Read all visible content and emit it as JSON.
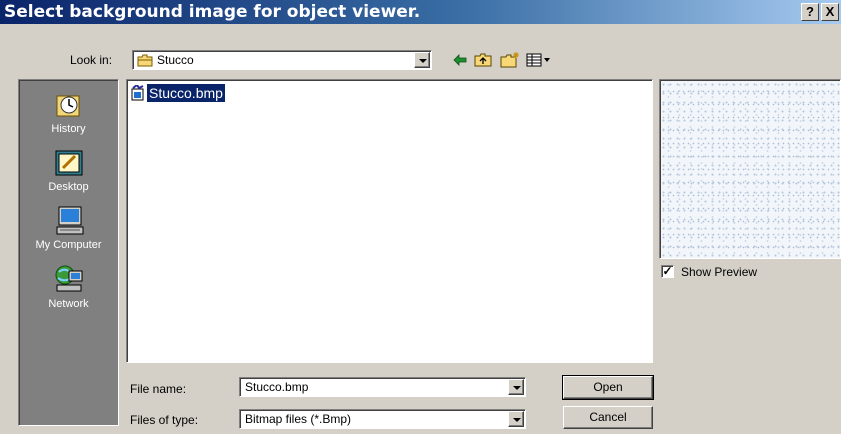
{
  "window": {
    "title": "Select background image for object viewer.",
    "help_label": "?",
    "close_label": "X"
  },
  "toolbar": {
    "look_in_label": "Look in:",
    "look_in_value": "Stucco"
  },
  "places": [
    {
      "label": "History",
      "icon": "history-icon"
    },
    {
      "label": "Desktop",
      "icon": "desktop-icon"
    },
    {
      "label": "My Computer",
      "icon": "my-computer-icon"
    },
    {
      "label": "Network",
      "icon": "network-icon"
    }
  ],
  "files": [
    {
      "name": "Stucco.bmp",
      "selected": true,
      "icon": "bitmap-file-icon"
    }
  ],
  "preview": {
    "show_preview_label": "Show Preview",
    "show_preview_checked": true
  },
  "form": {
    "file_name_label": "File name:",
    "file_name_value": "Stucco.bmp",
    "file_type_label": "Files of type:",
    "file_type_value": "Bitmap files (*.Bmp)",
    "open_label": "Open",
    "cancel_label": "Cancel"
  },
  "colors": {
    "title_bar_start": "#0a246a",
    "title_bar_end": "#a6caf0",
    "dialog_face": "#d4d0c8",
    "places_bar": "#808080",
    "selection": "#0a246a"
  }
}
